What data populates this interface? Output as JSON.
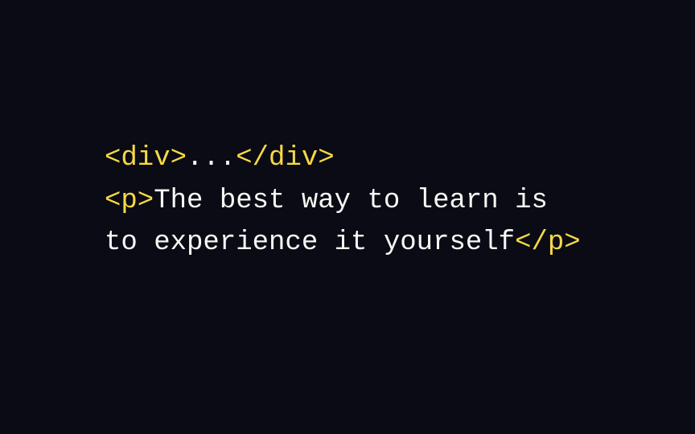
{
  "code": {
    "line1": {
      "open_div": "<div>",
      "ellipsis": "...",
      "close_div": "</div>"
    },
    "line2": {
      "open_p": "<p>",
      "sentence": "The best way to learn is to experience it yourself",
      "close_p": "</p>"
    }
  }
}
